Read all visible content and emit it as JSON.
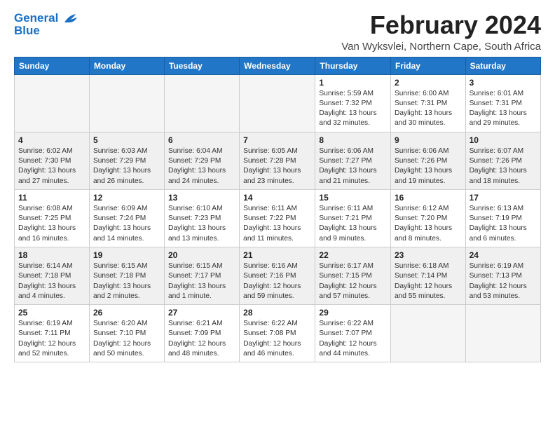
{
  "logo": {
    "line1": "General",
    "line2": "Blue"
  },
  "title": {
    "month_year": "February 2024",
    "location": "Van Wyksvlei, Northern Cape, South Africa"
  },
  "days_of_week": [
    "Sunday",
    "Monday",
    "Tuesday",
    "Wednesday",
    "Thursday",
    "Friday",
    "Saturday"
  ],
  "weeks": [
    [
      {
        "day": "",
        "info": ""
      },
      {
        "day": "",
        "info": ""
      },
      {
        "day": "",
        "info": ""
      },
      {
        "day": "",
        "info": ""
      },
      {
        "day": "1",
        "info": "Sunrise: 5:59 AM\nSunset: 7:32 PM\nDaylight: 13 hours\nand 32 minutes."
      },
      {
        "day": "2",
        "info": "Sunrise: 6:00 AM\nSunset: 7:31 PM\nDaylight: 13 hours\nand 30 minutes."
      },
      {
        "day": "3",
        "info": "Sunrise: 6:01 AM\nSunset: 7:31 PM\nDaylight: 13 hours\nand 29 minutes."
      }
    ],
    [
      {
        "day": "4",
        "info": "Sunrise: 6:02 AM\nSunset: 7:30 PM\nDaylight: 13 hours\nand 27 minutes."
      },
      {
        "day": "5",
        "info": "Sunrise: 6:03 AM\nSunset: 7:29 PM\nDaylight: 13 hours\nand 26 minutes."
      },
      {
        "day": "6",
        "info": "Sunrise: 6:04 AM\nSunset: 7:29 PM\nDaylight: 13 hours\nand 24 minutes."
      },
      {
        "day": "7",
        "info": "Sunrise: 6:05 AM\nSunset: 7:28 PM\nDaylight: 13 hours\nand 23 minutes."
      },
      {
        "day": "8",
        "info": "Sunrise: 6:06 AM\nSunset: 7:27 PM\nDaylight: 13 hours\nand 21 minutes."
      },
      {
        "day": "9",
        "info": "Sunrise: 6:06 AM\nSunset: 7:26 PM\nDaylight: 13 hours\nand 19 minutes."
      },
      {
        "day": "10",
        "info": "Sunrise: 6:07 AM\nSunset: 7:26 PM\nDaylight: 13 hours\nand 18 minutes."
      }
    ],
    [
      {
        "day": "11",
        "info": "Sunrise: 6:08 AM\nSunset: 7:25 PM\nDaylight: 13 hours\nand 16 minutes."
      },
      {
        "day": "12",
        "info": "Sunrise: 6:09 AM\nSunset: 7:24 PM\nDaylight: 13 hours\nand 14 minutes."
      },
      {
        "day": "13",
        "info": "Sunrise: 6:10 AM\nSunset: 7:23 PM\nDaylight: 13 hours\nand 13 minutes."
      },
      {
        "day": "14",
        "info": "Sunrise: 6:11 AM\nSunset: 7:22 PM\nDaylight: 13 hours\nand 11 minutes."
      },
      {
        "day": "15",
        "info": "Sunrise: 6:11 AM\nSunset: 7:21 PM\nDaylight: 13 hours\nand 9 minutes."
      },
      {
        "day": "16",
        "info": "Sunrise: 6:12 AM\nSunset: 7:20 PM\nDaylight: 13 hours\nand 8 minutes."
      },
      {
        "day": "17",
        "info": "Sunrise: 6:13 AM\nSunset: 7:19 PM\nDaylight: 13 hours\nand 6 minutes."
      }
    ],
    [
      {
        "day": "18",
        "info": "Sunrise: 6:14 AM\nSunset: 7:18 PM\nDaylight: 13 hours\nand 4 minutes."
      },
      {
        "day": "19",
        "info": "Sunrise: 6:15 AM\nSunset: 7:18 PM\nDaylight: 13 hours\nand 2 minutes."
      },
      {
        "day": "20",
        "info": "Sunrise: 6:15 AM\nSunset: 7:17 PM\nDaylight: 13 hours\nand 1 minute."
      },
      {
        "day": "21",
        "info": "Sunrise: 6:16 AM\nSunset: 7:16 PM\nDaylight: 12 hours\nand 59 minutes."
      },
      {
        "day": "22",
        "info": "Sunrise: 6:17 AM\nSunset: 7:15 PM\nDaylight: 12 hours\nand 57 minutes."
      },
      {
        "day": "23",
        "info": "Sunrise: 6:18 AM\nSunset: 7:14 PM\nDaylight: 12 hours\nand 55 minutes."
      },
      {
        "day": "24",
        "info": "Sunrise: 6:19 AM\nSunset: 7:13 PM\nDaylight: 12 hours\nand 53 minutes."
      }
    ],
    [
      {
        "day": "25",
        "info": "Sunrise: 6:19 AM\nSunset: 7:11 PM\nDaylight: 12 hours\nand 52 minutes."
      },
      {
        "day": "26",
        "info": "Sunrise: 6:20 AM\nSunset: 7:10 PM\nDaylight: 12 hours\nand 50 minutes."
      },
      {
        "day": "27",
        "info": "Sunrise: 6:21 AM\nSunset: 7:09 PM\nDaylight: 12 hours\nand 48 minutes."
      },
      {
        "day": "28",
        "info": "Sunrise: 6:22 AM\nSunset: 7:08 PM\nDaylight: 12 hours\nand 46 minutes."
      },
      {
        "day": "29",
        "info": "Sunrise: 6:22 AM\nSunset: 7:07 PM\nDaylight: 12 hours\nand 44 minutes."
      },
      {
        "day": "",
        "info": ""
      },
      {
        "day": "",
        "info": ""
      }
    ]
  ]
}
